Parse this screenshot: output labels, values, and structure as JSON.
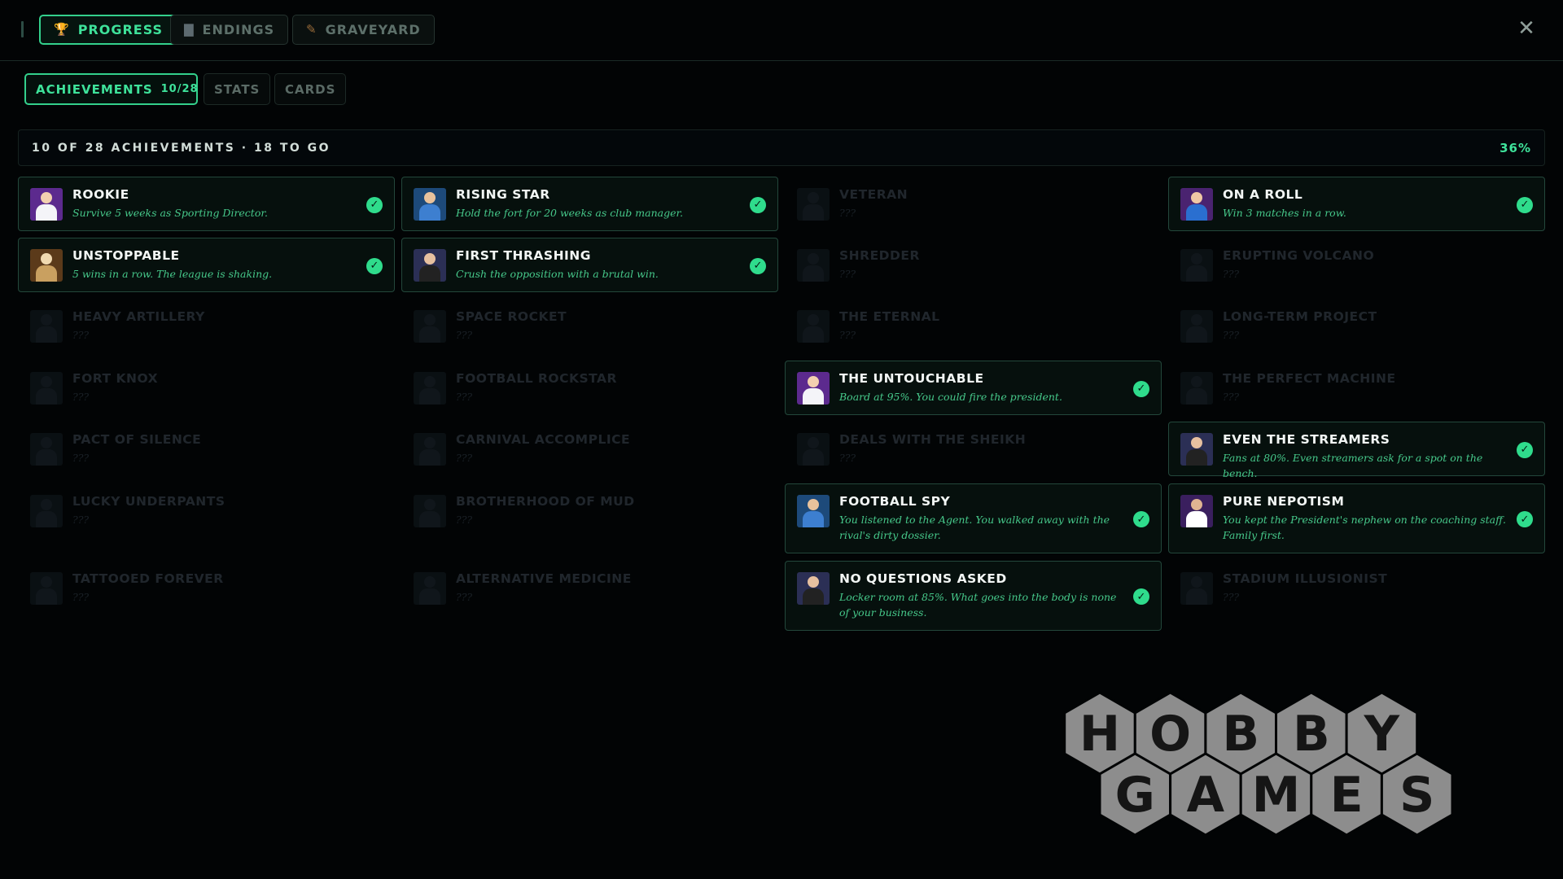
{
  "main_tabs": [
    {
      "label": "PROGRESS",
      "icon": "trophy-icon",
      "active": true
    },
    {
      "label": "ENDINGS",
      "icon": "book-icon",
      "active": false
    },
    {
      "label": "GRAVEYARD",
      "icon": "feather-icon",
      "active": false
    }
  ],
  "close_icon": "close-icon",
  "sub_tabs": [
    {
      "label": "ACHIEVEMENTS",
      "count": "10/28",
      "active": true
    },
    {
      "label": "STATS",
      "active": false
    },
    {
      "label": "CARDS",
      "active": false
    }
  ],
  "progress": {
    "text": "10 OF 28 ACHIEVEMENTS · 18 TO GO",
    "percent_label": "36%",
    "completed": 10,
    "total": 28
  },
  "colors": {
    "accent": "#33d08c",
    "check": "#2fdc8c",
    "description": "#46c88a"
  },
  "achievements": [
    {
      "title": "ROOKIE",
      "desc": "Survive 5 weeks as Sporting Director.",
      "unlocked": true
    },
    {
      "title": "RISING STAR",
      "desc": "Hold the fort for 20 weeks as club manager.",
      "unlocked": true
    },
    {
      "title": "VETERAN",
      "desc": "???",
      "unlocked": false
    },
    {
      "title": "ON A ROLL",
      "desc": "Win 3 matches in a row.",
      "unlocked": true
    },
    {
      "title": "UNSTOPPABLE",
      "desc": "5 wins in a row. The league is shaking.",
      "unlocked": true
    },
    {
      "title": "FIRST THRASHING",
      "desc": "Crush the opposition with a brutal win.",
      "unlocked": true
    },
    {
      "title": "SHREDDER",
      "desc": "???",
      "unlocked": false
    },
    {
      "title": "ERUPTING VOLCANO",
      "desc": "???",
      "unlocked": false
    },
    {
      "title": "HEAVY ARTILLERY",
      "desc": "???",
      "unlocked": false
    },
    {
      "title": "SPACE ROCKET",
      "desc": "???",
      "unlocked": false
    },
    {
      "title": "THE ETERNAL",
      "desc": "???",
      "unlocked": false
    },
    {
      "title": "LONG-TERM PROJECT",
      "desc": "???",
      "unlocked": false
    },
    {
      "title": "FORT KNOX",
      "desc": "???",
      "unlocked": false
    },
    {
      "title": "FOOTBALL ROCKSTAR",
      "desc": "???",
      "unlocked": false
    },
    {
      "title": "THE UNTOUCHABLE",
      "desc": "Board at 95%. You could fire the president.",
      "unlocked": true
    },
    {
      "title": "THE PERFECT MACHINE",
      "desc": "???",
      "unlocked": false
    },
    {
      "title": "PACT OF SILENCE",
      "desc": "???",
      "unlocked": false
    },
    {
      "title": "CARNIVAL ACCOMPLICE",
      "desc": "???",
      "unlocked": false
    },
    {
      "title": "DEALS WITH THE SHEIKH",
      "desc": "???",
      "unlocked": false
    },
    {
      "title": "EVEN THE STREAMERS",
      "desc": "Fans at 80%. Even streamers ask for a spot on the bench.",
      "unlocked": true
    },
    {
      "title": "LUCKY UNDERPANTS",
      "desc": "???",
      "unlocked": false
    },
    {
      "title": "BROTHERHOOD OF MUD",
      "desc": "???",
      "unlocked": false
    },
    {
      "title": "FOOTBALL SPY",
      "desc": "You listened to the Agent. You walked away with the rival's dirty dossier.",
      "unlocked": true
    },
    {
      "title": "PURE NEPOTISM",
      "desc": "You kept the President's nephew on the coaching staff. Family first.",
      "unlocked": true
    },
    {
      "title": "TATTOOED FOREVER",
      "desc": "???",
      "unlocked": false
    },
    {
      "title": "ALTERNATIVE MEDICINE",
      "desc": "???",
      "unlocked": false
    },
    {
      "title": "NO QUESTIONS ASKED",
      "desc": "Locker room at 85%. What goes into the body is none of your business.",
      "unlocked": true
    },
    {
      "title": "STADIUM ILLUSIONIST",
      "desc": "???",
      "unlocked": false
    }
  ],
  "logo": {
    "row1": [
      "H",
      "O",
      "B",
      "B",
      "Y"
    ],
    "row2": [
      "G",
      "A",
      "M",
      "E",
      "S"
    ]
  }
}
